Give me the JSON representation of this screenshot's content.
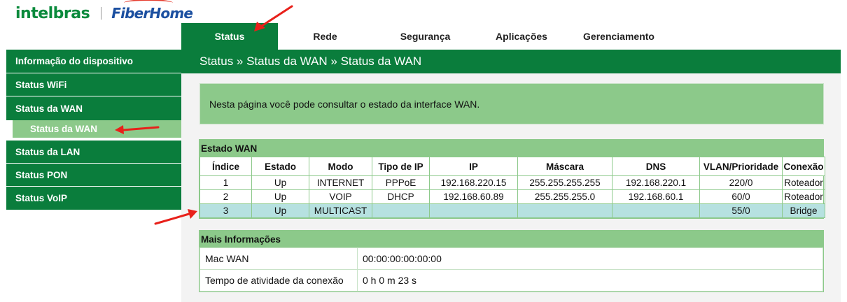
{
  "brand": {
    "primary": "intelbras",
    "secondary": "FiberHome"
  },
  "nav": {
    "tabs": [
      {
        "label": "Status"
      },
      {
        "label": "Rede"
      },
      {
        "label": "Segurança"
      },
      {
        "label": "Aplicações"
      },
      {
        "label": "Gerenciamento"
      }
    ]
  },
  "sidebar": {
    "items": [
      {
        "label": "Informação do dispositivo"
      },
      {
        "label": "Status WiFi"
      },
      {
        "label": "Status da WAN"
      },
      {
        "label": "Status da WAN"
      },
      {
        "label": "Status da LAN"
      },
      {
        "label": "Status PON"
      },
      {
        "label": "Status VoIP"
      }
    ]
  },
  "breadcrumb": "Status » Status da WAN » Status da WAN",
  "info_text": "Nesta página você pode consultar o estado da interface WAN.",
  "wan_table": {
    "title": "Estado WAN",
    "columns": [
      "Índice",
      "Estado",
      "Modo",
      "Tipo de IP",
      "IP",
      "Máscara",
      "DNS",
      "VLAN/Prioridade",
      "Conexão"
    ],
    "rows": [
      [
        "1",
        "Up",
        "INTERNET",
        "PPPoE",
        "192.168.220.15",
        "255.255.255.255",
        "192.168.220.1",
        "220/0",
        "Roteador"
      ],
      [
        "2",
        "Up",
        "VOIP",
        "DHCP",
        "192.168.60.89",
        "255.255.255.0",
        "192.168.60.1",
        "60/0",
        "Roteador"
      ],
      [
        "3",
        "Up",
        "MULTICAST",
        "",
        "",
        "",
        "",
        "55/0",
        "Bridge"
      ]
    ]
  },
  "more_info": {
    "title": "Mais Informações",
    "mac_label": "Mac WAN",
    "mac_value": "00:00:00:00:00:00",
    "uptime_label": "Tempo de atividade da conexão",
    "uptime_value": "0 h 0 m 23 s"
  },
  "colors": {
    "primary_green": "#0a7d3c",
    "light_green": "#8cc98a",
    "highlight_row": "#b6e1e0",
    "annotation_red": "#e8201a"
  }
}
